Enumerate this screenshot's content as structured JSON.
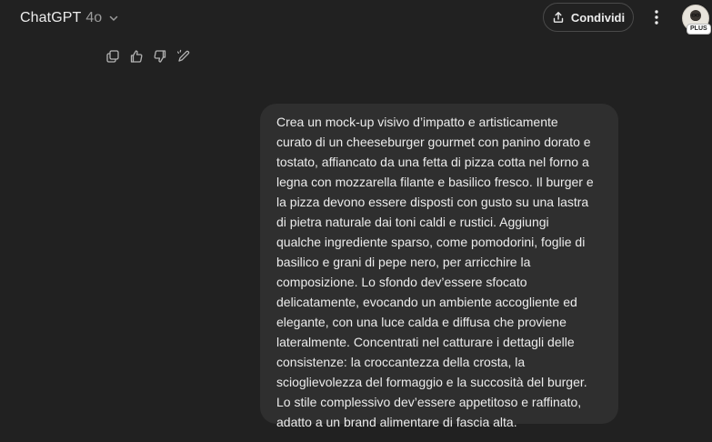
{
  "header": {
    "model_name": "ChatGPT",
    "model_version": "4o",
    "share_label": "Condividi",
    "avatar_badge": "PLUS"
  },
  "actions": {
    "icons": [
      "copy-icon",
      "thumbs-up-icon",
      "thumbs-down-icon",
      "edit-icon"
    ]
  },
  "conversation": {
    "user_message": "Crea un mock-up visivo d’impatto e artisticamente\ncurato di un cheeseburger gourmet con panino dorato e\ntostato, affiancato da una fetta di pizza cotta nel forno a\nlegna con mozzarella filante e basilico fresco. Il burger e\nla pizza devono essere disposti con gusto su una lastra\ndi pietra naturale dai toni caldi e rustici. Aggiungi\nqualche ingrediente sparso, come pomodorini, foglie di\nbasilico e grani di pepe nero, per arricchire la\ncomposizione. Lo sfondo dev’essere sfocato\ndelicatamente, evocando un ambiente accogliente ed\nelegante, con una luce calda e diffusa che proviene\nlateralmente. Concentrati nel catturare i dettagli delle\nconsistenze: la croccantezza della crosta, la\nscioglievolezza del formaggio e la succosità del burger.\nLo stile complessivo dev’essere appetitoso e raffinato,\nadatto a un brand alimentare di fascia alta."
  },
  "colors": {
    "background": "#212121",
    "bubble": "#2f2f2f",
    "text": "#ececec",
    "muted": "#9b9b9b"
  }
}
